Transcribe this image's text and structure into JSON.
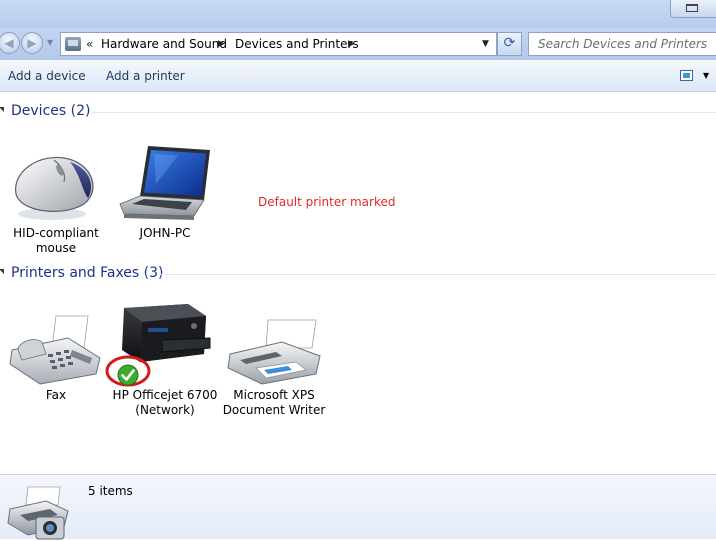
{
  "address_bar": {
    "overflow_marker": "«",
    "breadcrumbs": [
      "Hardware and Sound",
      "Devices and Printers"
    ],
    "search_placeholder": "Search Devices and Printers"
  },
  "toolbar": {
    "add_device": "Add a device",
    "add_printer": "Add a printer"
  },
  "groups": {
    "devices": {
      "title": "Devices (2)",
      "items": [
        {
          "label_lines": [
            "HID-compliant",
            "mouse"
          ],
          "icon": "mouse-icon"
        },
        {
          "label_lines": [
            "JOHN-PC"
          ],
          "icon": "laptop-icon"
        }
      ]
    },
    "printers": {
      "title": "Printers and Faxes (3)",
      "items": [
        {
          "label_lines": [
            "Fax"
          ],
          "icon": "fax-icon"
        },
        {
          "label_lines": [
            "HP Officejet 6700",
            "(Network)"
          ],
          "icon": "printer-icon",
          "default": true
        },
        {
          "label_lines": [
            "Microsoft XPS",
            "Document Writer"
          ],
          "icon": "printer-icon"
        }
      ]
    }
  },
  "annotation": {
    "text": "Default printer marked",
    "color": "#e32a2a"
  },
  "details": {
    "count": "5 items"
  },
  "colors": {
    "group_title": "#1e3287",
    "command_text": "#1e395b",
    "highlight_ring": "#d61a1a",
    "default_check": "#3caa2c"
  }
}
